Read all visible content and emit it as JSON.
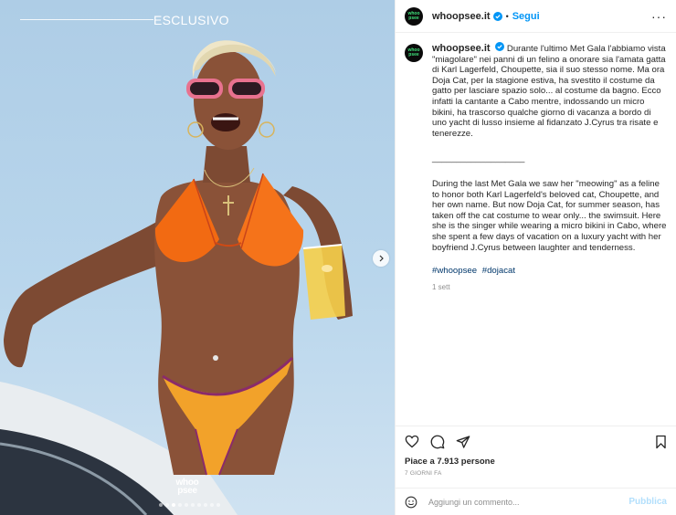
{
  "media": {
    "overlay_label": "ESCLUSIVO",
    "watermark_line1": "whoo",
    "watermark_line2": "psee",
    "carousel": {
      "count": 10,
      "active_index": 2
    },
    "colors": {
      "sky": "#b9d6ec",
      "bikini": "#f26a12",
      "skin": "#8a5238"
    }
  },
  "header": {
    "avatar_text_line1": "whoo",
    "avatar_text_line2": "psee",
    "username": "whoopsee.it",
    "separator": "•",
    "follow_label": "Segui",
    "more_label": "···"
  },
  "caption": {
    "username": "whoopsee.it",
    "text_it": "Durante l'ultimo Met Gala l'abbiamo vista \"miagolare\" nei panni di un felino a onorare sia l'amata gatta di Karl Lagerfeld, Choupette, sia il suo stesso nome. Ma ora Doja Cat, per la stagione estiva, ha svestito il costume da gatto per lasciare spazio solo... al costume da bagno. Ecco infatti la cantante a Cabo mentre, indossando un micro bikini, ha trascorso qualche giorno di vacanza a bordo di uno yacht di lusso insieme al fidanzato J.Cyrus tra risate e tenerezze.",
    "divider": "___________________",
    "text_en": "During the last Met Gala we saw her \"meowing\" as a feline to honor both Karl Lagerfeld's beloved cat, Choupette, and her own name. But now Doja Cat, for summer season, has taken off the cat costume to wear only... the swimsuit. Here she is the singer while wearing a micro bikini in Cabo, where she spent a few days of vacation on a luxury yacht with her boyfriend J.Cyrus between laughter and tenderness.",
    "hashtags": [
      "#whoopsee",
      "#dojacat"
    ],
    "time_ago": "1 sett"
  },
  "engagement": {
    "likes_text": "Piace a 7.913 persone",
    "date_text": "7 GIORNI FA"
  },
  "comment": {
    "placeholder": "Aggiungi un commento...",
    "publish_label": "Pubblica"
  },
  "colors": {
    "accent": "#0095f6",
    "verified": "#0095f6",
    "link": "#00376b",
    "muted": "#8e8e8e",
    "publish_disabled": "#b2dffc"
  },
  "icons": [
    "verified-badge-icon",
    "more-options-icon",
    "heart-icon",
    "comment-icon",
    "share-icon",
    "bookmark-icon",
    "emoji-icon",
    "chevron-right-icon"
  ]
}
